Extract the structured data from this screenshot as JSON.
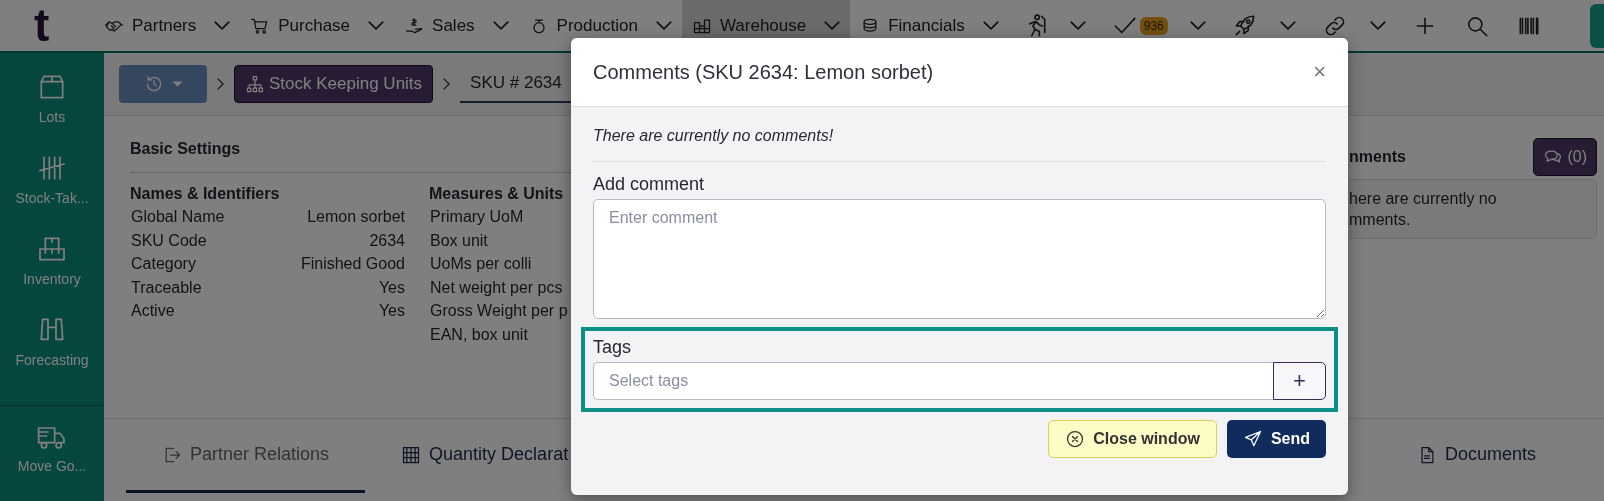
{
  "top_bar": {
    "logo": "t",
    "menus": [
      {
        "label": "Partners",
        "selected": false
      },
      {
        "label": "Purchase",
        "selected": false
      },
      {
        "label": "Sales",
        "selected": false
      },
      {
        "label": "Production",
        "selected": false
      },
      {
        "label": "Warehouse",
        "selected": true
      },
      {
        "label": "Financials",
        "selected": false
      }
    ],
    "tools": [
      {
        "kind": "runner",
        "dropdown": true
      },
      {
        "kind": "tasks",
        "dropdown": true,
        "badge": "936"
      },
      {
        "kind": "rocket",
        "dropdown": true
      },
      {
        "kind": "link",
        "dropdown": true
      },
      {
        "kind": "add",
        "dropdown": false
      },
      {
        "kind": "search",
        "dropdown": false
      },
      {
        "kind": "barcode",
        "dropdown": false
      }
    ]
  },
  "sidebar": {
    "items": [
      {
        "label": "Lots"
      },
      {
        "label": "Stock-Tak..."
      },
      {
        "label": "Inventory"
      },
      {
        "label": "Forecasting"
      }
    ],
    "bottom_items": [
      {
        "label": "Move Go..."
      }
    ]
  },
  "breadcrumb": [
    {
      "kind": "history"
    },
    {
      "kind": "link",
      "label": "Stock Keeping Units"
    },
    {
      "kind": "select",
      "label": "SKU # 2634"
    }
  ],
  "basic_settings": {
    "title": "Basic Settings",
    "groups": [
      {
        "title": "Names & Identifiers",
        "rows": [
          {
            "label": "Global Name",
            "value": "Lemon sorbet"
          },
          {
            "label": "SKU Code",
            "value": "2634"
          },
          {
            "label": "Category",
            "value": "Finished Good"
          },
          {
            "label": "Traceable",
            "value": "Yes"
          },
          {
            "label": "Active",
            "value": "Yes"
          }
        ]
      },
      {
        "title": "Measures & Units",
        "rows": [
          {
            "label": "Primary UoM"
          },
          {
            "label": "Box unit"
          },
          {
            "label": "UoMs per colli"
          },
          {
            "label": "Net weight per pcs"
          },
          {
            "label": "Gross Weight per p"
          },
          {
            "label": "EAN, box unit"
          }
        ]
      }
    ]
  },
  "comments_panel": {
    "title": "nments",
    "button": "(0)",
    "lines": [
      "here are currently no",
      "mments."
    ]
  },
  "tabs": [
    {
      "label": "Partner Relations",
      "selected": true
    },
    {
      "label": "Quantity Declarat",
      "selected": false
    }
  ],
  "right_tabs": [
    {
      "label": "Documents",
      "selected": false
    }
  ],
  "modal": {
    "title": "Comments (SKU 2634: Lemon sorbet)",
    "close": "×",
    "empty_message": "There are currently no comments!",
    "comment_field": {
      "label": "Add comment",
      "placeholder": "Enter comment"
    },
    "tags_field": {
      "label": "Tags",
      "placeholder": "Select tags",
      "add": "+",
      "highlighted": true
    },
    "buttons": [
      {
        "kind": "secondary",
        "label": "Close window"
      },
      {
        "kind": "primary",
        "label": "Send"
      }
    ]
  }
}
